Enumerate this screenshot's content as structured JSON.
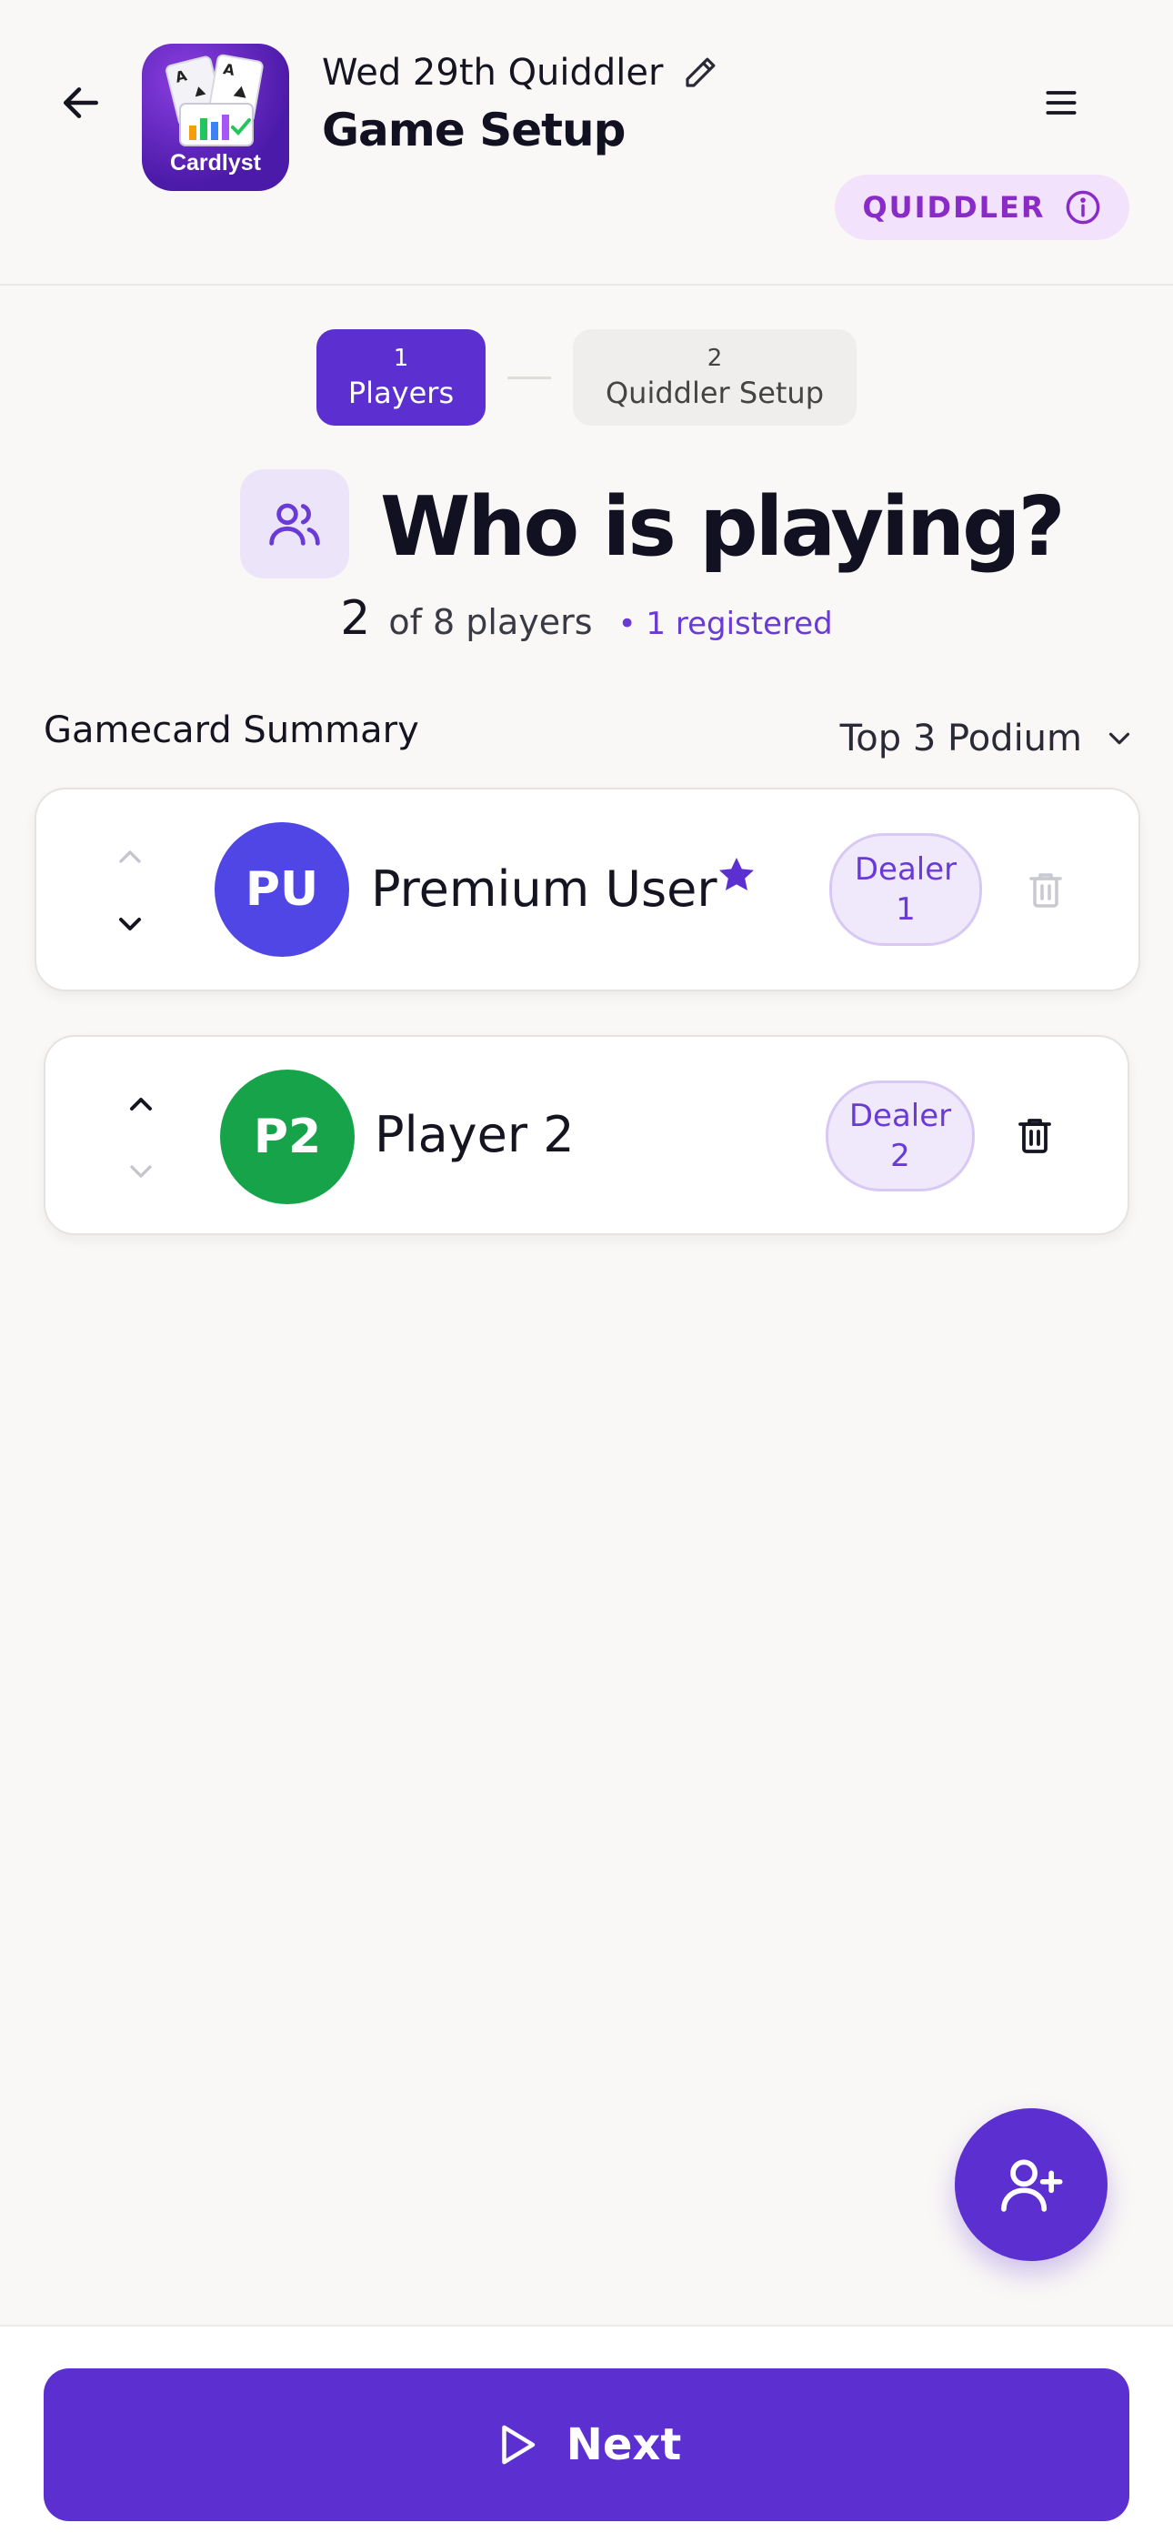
{
  "header": {
    "game_name": "Wed 29th Quiddler",
    "page_title": "Game Setup",
    "logo_text": "Cardlyst",
    "game_badge": "QUIDDLER"
  },
  "steps": [
    {
      "number": "1",
      "label": "Players",
      "active": true
    },
    {
      "number": "2",
      "label": "Quiddler Setup",
      "active": false
    }
  ],
  "hero": {
    "title": "Who is playing?",
    "player_count": "2",
    "player_limit_text": "of 8 players",
    "registered_text": "• 1 registered"
  },
  "summary": {
    "label": "Gamecard Summary",
    "selected_option": "Top 3 Podium"
  },
  "players": [
    {
      "initials": "PU",
      "name": "Premium User",
      "premium": true,
      "avatar_color": "#4f46e5",
      "dealer_label": "Dealer",
      "dealer_number": "1"
    },
    {
      "initials": "P2",
      "name": "Player 2",
      "premium": false,
      "avatar_color": "#16a34a",
      "dealer_label": "Dealer",
      "dealer_number": "2"
    }
  ],
  "footer": {
    "next_label": "Next"
  },
  "colors": {
    "accent": "#5c2fd1",
    "badge_bg": "#f2e2fb",
    "badge_text": "#8a2bc8"
  },
  "icons": {
    "back": "arrow-left-icon",
    "edit": "pencil-icon",
    "menu": "hamburger-icon",
    "info": "info-icon",
    "hero": "users-icon",
    "dropdown": "chevron-down-icon",
    "move_up": "chevron-up-icon",
    "move_down": "chevron-down-icon",
    "premium": "star-icon",
    "delete": "trash-icon",
    "add_player": "user-plus-icon",
    "next": "play-icon"
  }
}
